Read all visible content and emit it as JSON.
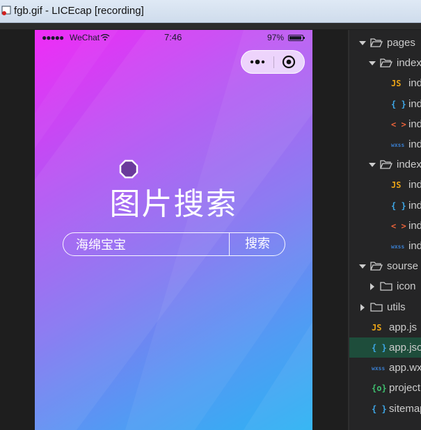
{
  "window": {
    "title": "fgb.gif - LICEcap [recording]"
  },
  "status_bar": {
    "signal": "●●●●●",
    "carrier": "WeChat",
    "time": "7:46",
    "battery": "97%"
  },
  "capsule": {
    "more_label": "•●•"
  },
  "page": {
    "title": "图片搜索"
  },
  "search": {
    "value": "海绵宝宝",
    "button_label": "搜索"
  },
  "file_tree": [
    {
      "label": "pages",
      "type": "folder",
      "expanded": true,
      "depth": 0
    },
    {
      "label": "index",
      "type": "folder",
      "expanded": true,
      "depth": 1
    },
    {
      "label": "index.js",
      "type": "js",
      "icon": "JS",
      "depth": 2
    },
    {
      "label": "index.json",
      "type": "json",
      "icon": "{ }",
      "depth": 2
    },
    {
      "label": "index.wxml",
      "type": "wxml",
      "icon": "< >",
      "depth": 2
    },
    {
      "label": "index.wxss",
      "type": "wxss",
      "icon": "wxss",
      "depth": 2
    },
    {
      "label": "index",
      "type": "folder",
      "expanded": true,
      "depth": 1
    },
    {
      "label": "index.js",
      "type": "js",
      "icon": "JS",
      "depth": 2
    },
    {
      "label": "index.json",
      "type": "json",
      "icon": "{ }",
      "depth": 2
    },
    {
      "label": "index.wxml",
      "type": "wxml",
      "icon": "< >",
      "depth": 2
    },
    {
      "label": "index.wxss",
      "type": "wxss",
      "icon": "wxss",
      "depth": 2
    },
    {
      "label": "sourse",
      "type": "folder",
      "expanded": true,
      "depth": 0
    },
    {
      "label": "icon",
      "type": "folder",
      "expanded": false,
      "depth": 1
    },
    {
      "label": "utils",
      "type": "folder",
      "expanded": false,
      "depth": 0
    },
    {
      "label": "app.js",
      "type": "js",
      "icon": "JS",
      "depth": 0
    },
    {
      "label": "app.json",
      "type": "json",
      "icon": "{ }",
      "depth": 0,
      "selected": true
    },
    {
      "label": "app.wxss",
      "type": "wxss",
      "icon": "wxss",
      "depth": 0
    },
    {
      "label": "project.config.json",
      "type": "config",
      "icon": "{o}",
      "depth": 0
    },
    {
      "label": "sitemap.json",
      "type": "json",
      "icon": "{ }",
      "depth": 0
    }
  ],
  "colors": {
    "gradient_start": "#f02cf6",
    "gradient_end": "#2bb3f3",
    "js_icon": "#e8a317",
    "json_icon": "#3ea8e8",
    "wxml_icon": "#e8623a",
    "wxss_icon": "#3a7fd0",
    "config_icon": "#3fbf6f",
    "selected_row": "#1e4d3b"
  }
}
